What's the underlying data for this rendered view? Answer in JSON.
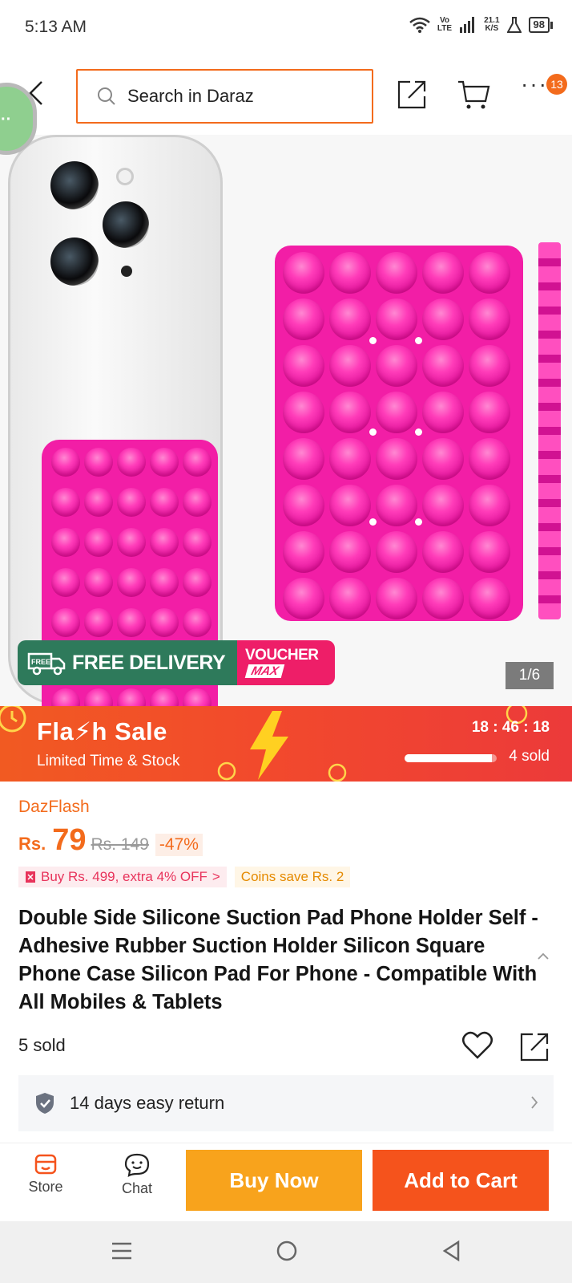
{
  "status_bar": {
    "time": "5:13 AM",
    "network_label_top": "Vo",
    "network_label_bottom": "LTE",
    "speed_top": "21.1",
    "speed_bottom": "K/S",
    "battery": "98"
  },
  "header": {
    "search_placeholder": "Search in Daraz",
    "cart_badge": "13",
    "icons": [
      "back-icon",
      "search-icon",
      "share-icon",
      "cart-icon",
      "more-icon"
    ]
  },
  "gallery": {
    "free_delivery_label": "FREE DELIVERY",
    "free_badge": "FREE",
    "voucher_top": "VOUCHER",
    "voucher_bottom": "MAX",
    "page_counter": "1/6"
  },
  "flash_sale": {
    "title": "Fla⚡h Sale",
    "subtitle": "Limited Time & Stock",
    "timer": "18 : 46 : 18",
    "sold": "4 sold",
    "progress": 0.95
  },
  "product": {
    "store": "DazFlash",
    "currency": "Rs.",
    "price": "79",
    "old_price": "Rs. 149",
    "discount": "-47%",
    "promo": "Buy Rs. 499, extra 4% OFF",
    "promo_arrow": ">",
    "coins": "Coins save Rs. 2",
    "title": "Double Side Silicone Suction Pad Phone Holder Self - Adhesive Rubber Suction Holder Silicon Square Phone Case Silicon Pad For Phone - Compatible With All Mobiles & Tablets",
    "sold": "5 sold",
    "return_policy": "14 days easy return"
  },
  "action_bar": {
    "store_label": "Store",
    "chat_label": "Chat",
    "buy_now": "Buy Now",
    "add_to_cart": "Add to Cart"
  },
  "colors": {
    "brand_orange": "#f36b1c",
    "buy_now": "#f8a31c",
    "add_to_cart": "#f5531c",
    "pad_pink": "#f21ea6",
    "delivery_green": "#2e7a5b"
  }
}
